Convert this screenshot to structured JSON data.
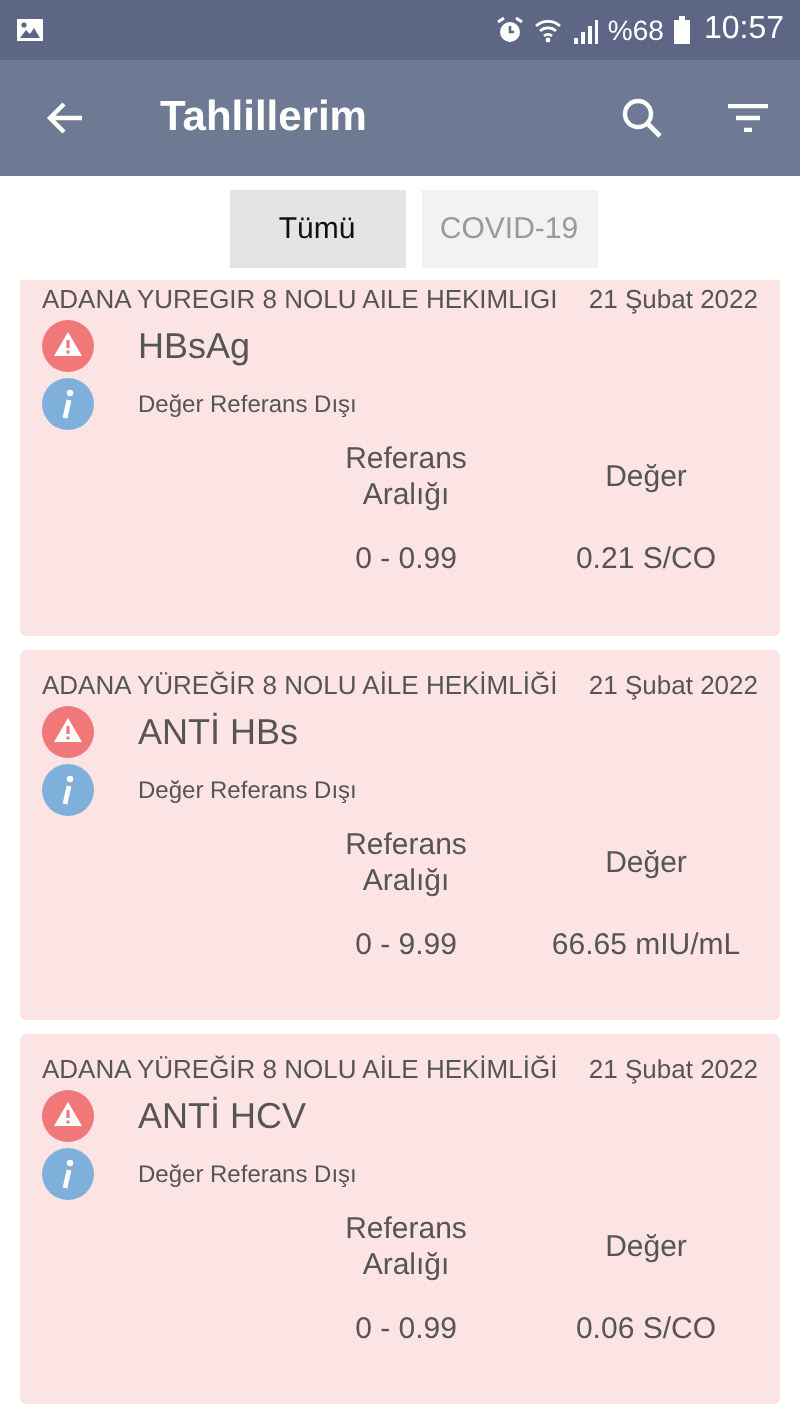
{
  "status_bar": {
    "battery": "%68",
    "time": "10:57"
  },
  "app_bar": {
    "title": "Tahlillerim"
  },
  "tabs": [
    {
      "label": "Tümü",
      "selected": true
    },
    {
      "label": "COVID-19",
      "selected": false
    }
  ],
  "results": [
    {
      "clinic": "ADANA YUREGIR 8 NOLU AILE HEKIMLIGI",
      "date": "21 Şubat 2022",
      "test": "HBsAg",
      "note": "Değer Referans Dışı",
      "range_label": "Referans Aralığı",
      "value_label": "Değer",
      "range": "0 - 0.99",
      "value": "0.21 S/CO"
    },
    {
      "clinic": "ADANA YÜREĞİR 8 NOLU AİLE HEKİMLİĞİ",
      "date": "21 Şubat 2022",
      "test": "ANTİ HBs",
      "note": "Değer Referans Dışı",
      "range_label": "Referans Aralığı",
      "value_label": "Değer",
      "range": "0 - 9.99",
      "value": "66.65 mIU/mL"
    },
    {
      "clinic": "ADANA YÜREĞİR 8 NOLU AİLE HEKİMLİĞİ",
      "date": "21 Şubat 2022",
      "test": "ANTİ HCV",
      "note": "Değer Referans Dışı",
      "range_label": "Referans Aralığı",
      "value_label": "Değer",
      "range": "0 - 0.99",
      "value": "0.06 S/CO"
    }
  ]
}
